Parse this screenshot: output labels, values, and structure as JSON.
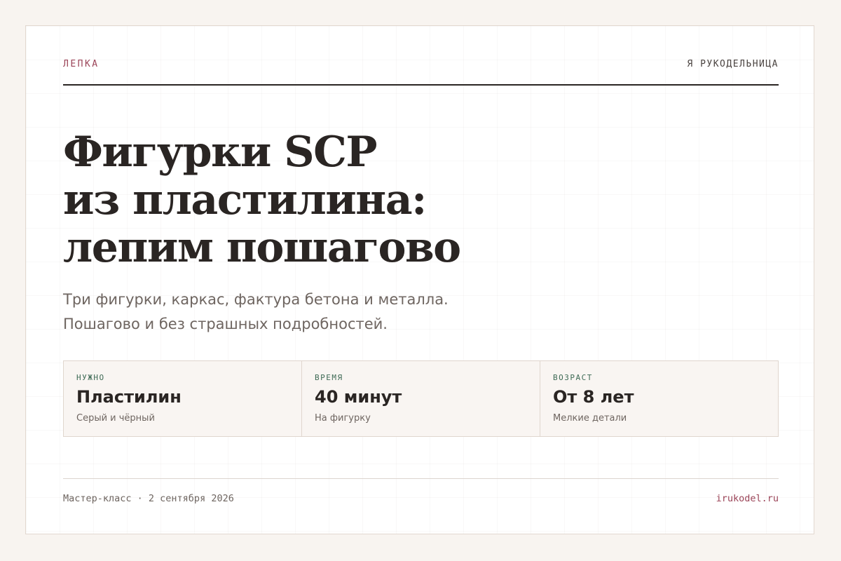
{
  "header": {
    "category": "ЛЕПКА",
    "brand": "Я РУКОДЕЛЬНИЦА"
  },
  "title_lines": [
    "Фигурки SCP",
    "из пластилина:",
    "лепим пошагово"
  ],
  "subtitle_lines": [
    "Три фигурки, каркас, фактура бетона и металла.",
    "Пошагово и без страшных подробностей."
  ],
  "facts": [
    {
      "label": "НУЖНО",
      "value": "Пластилин",
      "note": "Серый и чёрный"
    },
    {
      "label": "ВРЕМЯ",
      "value": "40 минут",
      "note": "На фигурку"
    },
    {
      "label": "ВОЗРАСТ",
      "value": "От 8 лет",
      "note": "Мелкие детали"
    }
  ],
  "footer": {
    "event": "Мастер-класс · 2 сентября 2026",
    "site": "irukodel.ru"
  },
  "colors": {
    "accent": "#9b4458",
    "label_green": "#3e6a55",
    "text_dark": "#2a2523",
    "text_muted": "#6e6560",
    "page_bg": "#f8f4f0"
  }
}
